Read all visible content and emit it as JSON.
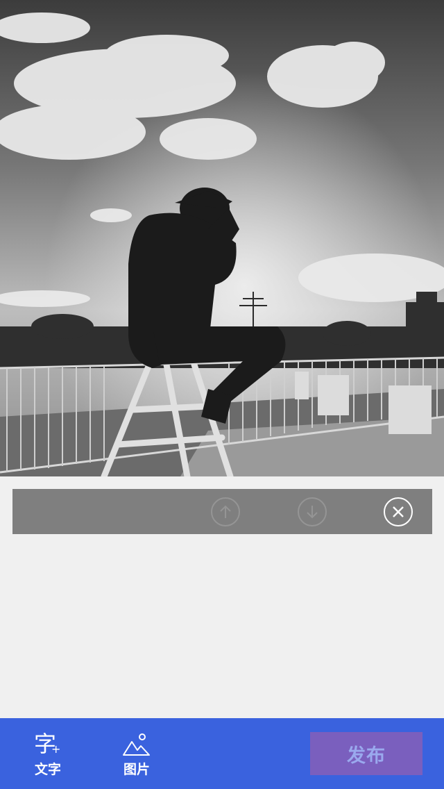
{
  "photo": {
    "description_icon": "photo-image",
    "colors": {
      "sky": "#8a8a8a",
      "cloud": "#e6e6e6",
      "silhouette": "#1b1b1b"
    }
  },
  "item_toolbar": {
    "move_up_icon": "arrow-up-circle-icon",
    "move_down_icon": "arrow-down-circle-icon",
    "delete_icon": "close-circle-icon",
    "background_color": "#7f7f7f"
  },
  "bottom_bar": {
    "background_color": "#3a62de",
    "tools": {
      "text": {
        "glyph": "字",
        "label": "文字",
        "icon": "add-text-icon"
      },
      "image": {
        "label": "图片",
        "icon": "add-image-icon"
      }
    },
    "publish": {
      "label": "发布",
      "color": "#7a5fbe"
    }
  }
}
